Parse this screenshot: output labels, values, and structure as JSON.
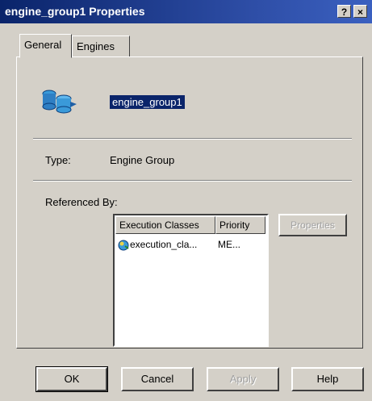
{
  "window": {
    "title": "engine_group1 Properties"
  },
  "titlebar_buttons": {
    "help": "?",
    "close": "×"
  },
  "tabs": [
    {
      "label": "General"
    },
    {
      "label": "Engines"
    }
  ],
  "general": {
    "icon": "engine-group-icon",
    "name": "engine_group1",
    "type_label": "Type:",
    "type_value": "Engine Group",
    "referenced_by_label": "Referenced By:"
  },
  "references": {
    "columns": [
      "Execution Classes",
      "Priority"
    ],
    "rows": [
      {
        "icon": "execution-class-icon",
        "name": "execution_cla...",
        "priority": "ME..."
      }
    ],
    "properties_label": "Properties"
  },
  "buttons": {
    "ok": "OK",
    "cancel": "Cancel",
    "apply": "Apply",
    "help": "Help"
  },
  "colors": {
    "titlebar": "#0a246a",
    "face": "#d4d0c8",
    "selection": "#0a246a"
  }
}
